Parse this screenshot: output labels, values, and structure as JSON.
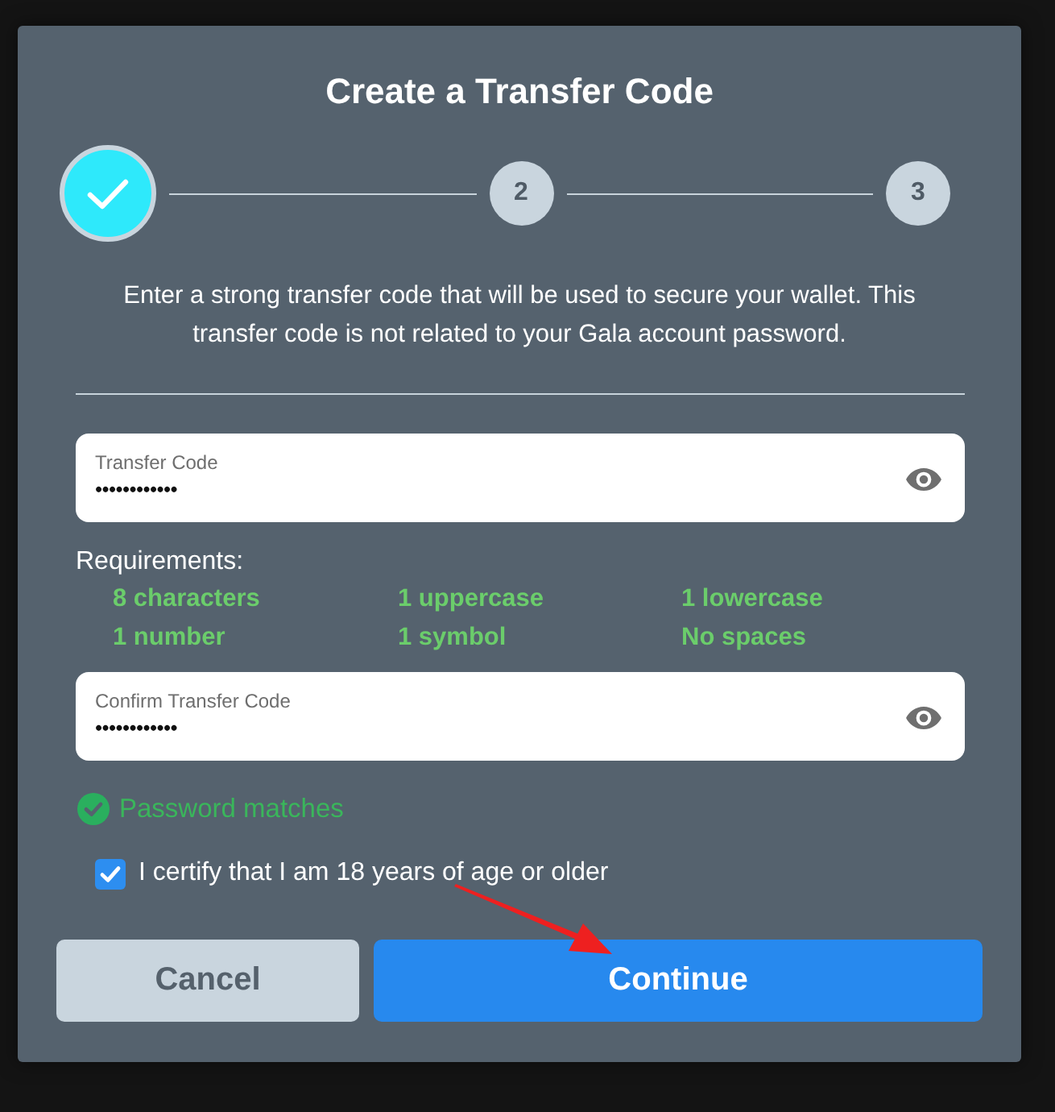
{
  "dialog": {
    "title": "Create a Transfer Code"
  },
  "stepper": {
    "steps": [
      {
        "completed": true
      },
      {
        "completed": false,
        "label": "2"
      },
      {
        "completed": false,
        "label": "3"
      }
    ]
  },
  "description": "Enter a strong transfer code that will be used to secure your wallet. This transfer code is not related to your Gala account password.",
  "fields": [
    {
      "label": "Transfer Code",
      "value": "••••••••••••"
    }
  ],
  "requirements": {
    "title": "Requirements:",
    "items": [
      {
        "text": "8 characters",
        "met": true
      },
      {
        "text": "1 uppercase",
        "met": true
      },
      {
        "text": "1 lowercase",
        "met": true
      },
      {
        "text": "1 number",
        "met": true
      },
      {
        "text": "1 symbol",
        "met": true
      },
      {
        "text": "No spaces",
        "met": true
      }
    ]
  },
  "confirm_field": {
    "label": "Confirm Transfer Code",
    "value": "••••••••••••"
  },
  "match_status": {
    "text": "Password matches",
    "matched": true
  },
  "certify": {
    "label": "I certify that I am 18 years of age or older",
    "checked": true
  },
  "buttons": [
    {
      "label": "Cancel",
      "kind": "secondary"
    },
    {
      "label": "Continue",
      "kind": "primary"
    }
  ]
}
